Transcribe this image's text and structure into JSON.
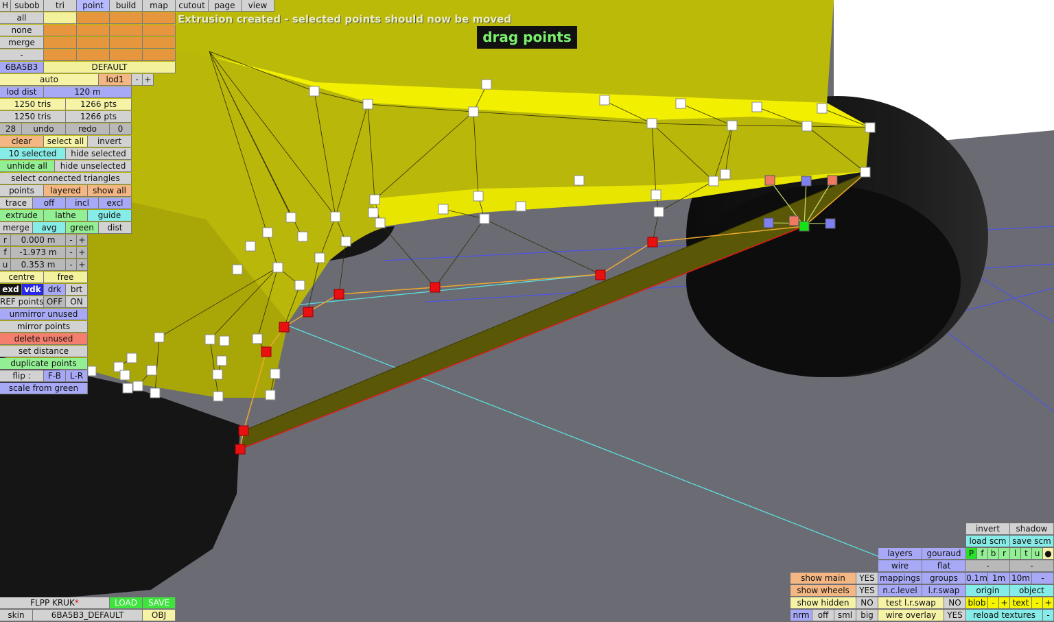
{
  "status_message": "Extrusion created - selected points should now be moved",
  "mode_badge": "drag points",
  "menu": {
    "h": "H",
    "tabs": [
      "subob",
      "tri",
      "point",
      "build",
      "map",
      "cutout",
      "page",
      "view"
    ]
  },
  "selection": {
    "all": "all",
    "none": "none",
    "merge": "merge",
    "dash": "-",
    "color_code": "6BA5B3",
    "skin_name": "DEFAULT",
    "auto": "auto",
    "lod": "lod1",
    "minus": "-",
    "plus": "+"
  },
  "lod": {
    "label": "lod dist",
    "value": "120 m"
  },
  "stats": {
    "tris_a": "1250 tris",
    "pts_a": "1266 pts",
    "tris_b": "1250 tris",
    "pts_b": "1266 pts"
  },
  "undo": {
    "count": "28",
    "undo": "undo",
    "redo": "redo",
    "redo_count": "0"
  },
  "edit": {
    "clear": "clear",
    "select_all": "select all",
    "invert": "invert",
    "selected": "10 selected",
    "hide_selected": "hide selected",
    "unhide_all": "unhide all",
    "hide_unselected": "hide unselected",
    "select_connected": "select connected triangles",
    "points": "points",
    "layered": "layered",
    "show_all": "show all",
    "trace": "trace",
    "off": "off",
    "incl": "incl",
    "excl": "excl",
    "extrude": "extrude",
    "lathe": "lathe",
    "guide": "guide",
    "merge": "merge",
    "avg": "avg",
    "green": "green",
    "dist": "dist"
  },
  "coords": [
    {
      "axis": "r",
      "value": "0.000 m"
    },
    {
      "axis": "f",
      "value": "-1.973 m"
    },
    {
      "axis": "u",
      "value": "0.353 m"
    }
  ],
  "pivot": {
    "centre": "centre",
    "free": "free"
  },
  "view_mode": {
    "exd": "exd",
    "vdk": "vdk",
    "drk": "drk",
    "brt": "brt"
  },
  "ref_points": {
    "label": "REF points",
    "off": "OFF",
    "on": "ON"
  },
  "actions": {
    "unmirror": "unmirror unused",
    "mirror": "mirror points",
    "delete": "delete unused",
    "set_distance": "set distance",
    "flip": "flip :",
    "fb": "F-B",
    "lr": "L-R",
    "duplicate": "duplicate points",
    "scale_green": "scale from green"
  },
  "file": {
    "name": "FLPP KRUK",
    "modified_mark": "*",
    "load": "LOAD",
    "save": "SAVE",
    "skin_label": "skin",
    "skin_value": "6BA5B3_DEFAULT",
    "obj": "OBJ"
  },
  "display": {
    "invert": "invert",
    "shadow": "shadow",
    "load_scm": "load scm",
    "save_scm": "save scm",
    "layers": "layers",
    "gouraud": "gouraud",
    "flags": [
      "P",
      "f",
      "b",
      "r",
      "l",
      "t",
      "u",
      "●"
    ],
    "wire": "wire",
    "flat": "flat",
    "dash": "-",
    "show_main": "show main",
    "show_main_val": "YES",
    "mappings": "mappings",
    "groups": "groups",
    "grid": [
      "0.1m",
      "1m",
      "10m",
      "-"
    ],
    "show_wheels": "show wheels",
    "show_wheels_val": "YES",
    "nc_level": "n.c.level",
    "lr_swap": "l.r.swap",
    "origin": "origin",
    "object": "object",
    "show_hidden": "show hidden",
    "show_hidden_val": "NO",
    "test_lr_swap": "test l.r.swap",
    "test_lr_swap_val": "NO",
    "blob": "blob",
    "text": "text",
    "nrm": "nrm",
    "off": "off",
    "sml": "sml",
    "big": "big",
    "wire_overlay": "wire overlay",
    "wire_overlay_val": "YES",
    "reload_textures": "reload textures"
  },
  "colors": {
    "body_yellow": "#d8d60e",
    "floor": "#6b6c73",
    "tyre": "#151515",
    "selected_point": "#e81010",
    "green_point": "#18e018",
    "status_text": "#e9edb8",
    "badge_text": "#7cf06e"
  }
}
